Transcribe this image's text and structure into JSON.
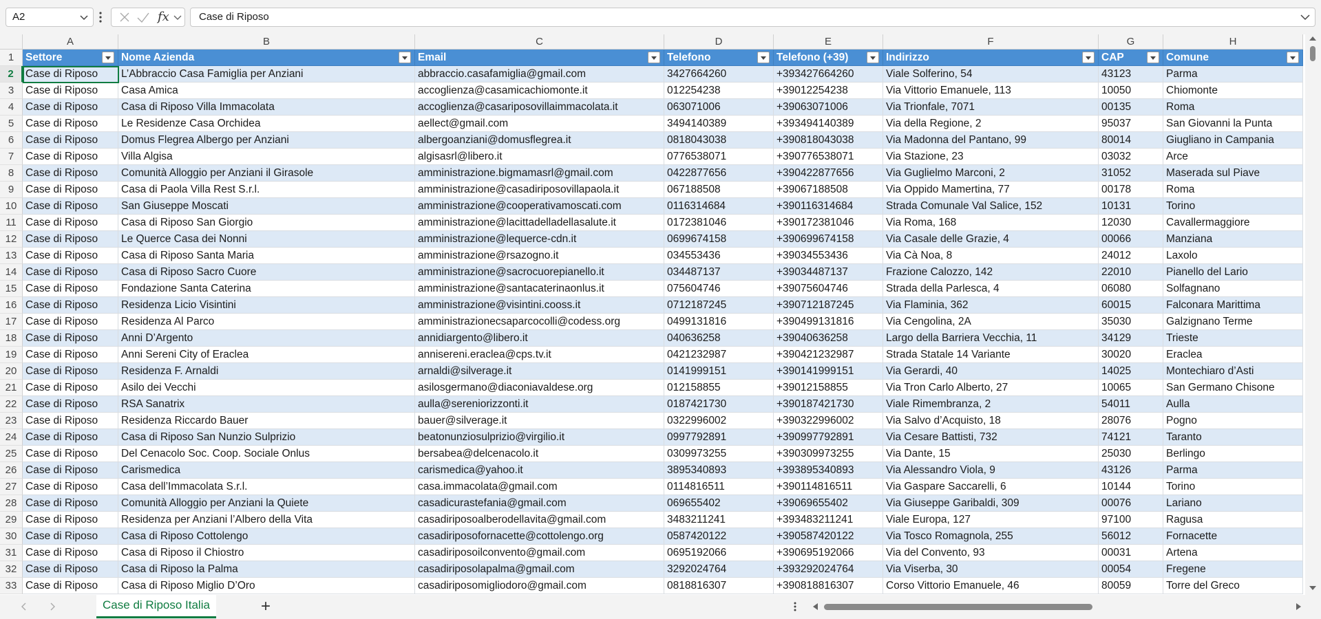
{
  "formula_bar": {
    "name_box": "A2",
    "formula": "Case di Riposo",
    "fx_label": "fx"
  },
  "columns": [
    "A",
    "B",
    "C",
    "D",
    "E",
    "F",
    "G",
    "H"
  ],
  "row_numbers": [
    "1",
    "2",
    "3",
    "4",
    "5",
    "6",
    "7",
    "8",
    "9",
    "10",
    "11",
    "12",
    "13",
    "14",
    "15",
    "16",
    "17",
    "18",
    "19",
    "20",
    "21",
    "22",
    "23",
    "24",
    "25",
    "26",
    "27",
    "28",
    "29",
    "30",
    "31",
    "32",
    "33"
  ],
  "table": {
    "headers": [
      "Settore",
      "Nome Azienda",
      "Email",
      "Telefono",
      "Telefono (+39)",
      "Indirizzo",
      "CAP",
      "Comune"
    ],
    "rows": [
      [
        "Case di Riposo",
        "L’Abbraccio Casa Famiglia per Anziani",
        "abbraccio.casafamiglia@gmail.com",
        "3427664260",
        "+393427664260",
        "Viale Solferino, 54",
        "43123",
        "Parma"
      ],
      [
        "Case di Riposo",
        "Casa Amica",
        "accoglienza@casamicachiomonte.it",
        "012254238",
        "+39012254238",
        "Via Vittorio Emanuele, 113",
        "10050",
        "Chiomonte"
      ],
      [
        "Case di Riposo",
        "Casa di Riposo Villa Immacolata",
        "accoglienza@casariposovillaimmacolata.it",
        "063071006",
        "+39063071006",
        "Via Trionfale, 7071",
        "00135",
        "Roma"
      ],
      [
        "Case di Riposo",
        "Le Residenze Casa Orchidea",
        "aellect@gmail.com",
        "3494140389",
        "+393494140389",
        "Via della Regione, 2",
        "95037",
        "San Giovanni la Punta"
      ],
      [
        "Case di Riposo",
        "Domus Flegrea Albergo per Anziani",
        "albergoanziani@domusflegrea.it",
        "0818043038",
        "+390818043038",
        "Via Madonna del Pantano, 99",
        "80014",
        "Giugliano in Campania"
      ],
      [
        "Case di Riposo",
        "Villa Algisa",
        "algisasrl@libero.it",
        "0776538071",
        "+390776538071",
        "Via Stazione, 23",
        "03032",
        "Arce"
      ],
      [
        "Case di Riposo",
        "Comunità Alloggio per Anziani il Girasole",
        "amministrazione.bigmamasrl@gmail.com",
        "0422877656",
        "+390422877656",
        "Via Guglielmo Marconi, 2",
        "31052",
        "Maserada sul Piave"
      ],
      [
        "Case di Riposo",
        "Casa di Paola Villa Rest S.r.l.",
        "amministrazione@casadiriposovillapaola.it",
        "067188508",
        "+39067188508",
        "Via Oppido Mamertina, 77",
        "00178",
        "Roma"
      ],
      [
        "Case di Riposo",
        "San Giuseppe Moscati",
        "amministrazione@cooperativamoscati.com",
        "0116314684",
        "+390116314684",
        "Strada Comunale Val Salice, 152",
        "10131",
        "Torino"
      ],
      [
        "Case di Riposo",
        "Casa di Riposo San Giorgio",
        "amministrazione@lacittadelladellasalute.it",
        "0172381046",
        "+390172381046",
        "Via Roma, 168",
        "12030",
        "Cavallermaggiore"
      ],
      [
        "Case di Riposo",
        "Le Querce Casa dei Nonni",
        "amministrazione@lequerce-cdn.it",
        "0699674158",
        "+390699674158",
        "Via Casale delle Grazie, 4",
        "00066",
        "Manziana"
      ],
      [
        "Case di Riposo",
        "Casa di Riposo Santa Maria",
        "amministrazione@rsazogno.it",
        "034553436",
        "+39034553436",
        "Via Cà Noa, 8",
        "24012",
        "Laxolo"
      ],
      [
        "Case di Riposo",
        "Casa di Riposo Sacro Cuore",
        "amministrazione@sacrocuorepianello.it",
        "034487137",
        "+39034487137",
        "Frazione Calozzo, 142",
        "22010",
        "Pianello del Lario"
      ],
      [
        "Case di Riposo",
        "Fondazione Santa Caterina",
        "amministrazione@santacaterinaonlus.it",
        "075604746",
        "+39075604746",
        "Strada della Parlesca, 4",
        "06080",
        "Solfagnano"
      ],
      [
        "Case di Riposo",
        "Residenza Licio Visintini",
        "amministrazione@visintini.cooss.it",
        "0712187245",
        "+390712187245",
        "Via Flaminia, 362",
        "60015",
        "Falconara Marittima"
      ],
      [
        "Case di Riposo",
        "Residenza Al Parco",
        "amministrazionecsaparcocolli@codess.org",
        "0499131816",
        "+390499131816",
        "Via Cengolina, 2A",
        "35030",
        "Galzignano Terme"
      ],
      [
        "Case di Riposo",
        "Anni D’Argento",
        "annidiargento@libero.it",
        "040636258",
        "+39040636258",
        "Largo della Barriera Vecchia, 11",
        "34129",
        "Trieste"
      ],
      [
        "Case di Riposo",
        "Anni Sereni City of Eraclea",
        "annisereni.eraclea@cps.tv.it",
        "0421232987",
        "+390421232987",
        "Strada Statale 14 Variante",
        "30020",
        "Eraclea"
      ],
      [
        "Case di Riposo",
        "Residenza F. Arnaldi",
        "arnaldi@silverage.it",
        "0141999151",
        "+390141999151",
        "Via Gerardi, 40",
        "14025",
        "Montechiaro d’Asti"
      ],
      [
        "Case di Riposo",
        "Asilo dei Vecchi",
        "asilosgermano@diaconiavaldese.org",
        "012158855",
        "+39012158855",
        "Via Tron Carlo Alberto, 27",
        "10065",
        "San Germano Chisone"
      ],
      [
        "Case di Riposo",
        "RSA Sanatrix",
        "aulla@sereniorizzonti.it",
        "0187421730",
        "+390187421730",
        "Viale Rimembranza, 2",
        "54011",
        "Aulla"
      ],
      [
        "Case di Riposo",
        "Residenza Riccardo Bauer",
        "bauer@silverage.it",
        "0322996002",
        "+390322996002",
        "Via Salvo d’Acquisto, 18",
        "28076",
        "Pogno"
      ],
      [
        "Case di Riposo",
        "Casa di Riposo San Nunzio Sulprizio",
        "beatonunziosulprizio@virgilio.it",
        "0997792891",
        "+390997792891",
        "Via Cesare Battisti, 732",
        "74121",
        "Taranto"
      ],
      [
        "Case di Riposo",
        "Del Cenacolo Soc. Coop. Sociale Onlus",
        "bersabea@delcenacolo.it",
        "0309973255",
        "+390309973255",
        "Via Dante, 15",
        "25030",
        "Berlingo"
      ],
      [
        "Case di Riposo",
        "Carismedica",
        "carismedica@yahoo.it",
        "3895340893",
        "+393895340893",
        "Via Alessandro Viola, 9",
        "43126",
        "Parma"
      ],
      [
        "Case di Riposo",
        "Casa dell’Immacolata S.r.l.",
        "casa.immacolata@gmail.com",
        "0114816511",
        "+390114816511",
        "Via Gaspare Saccarelli, 6",
        "10144",
        "Torino"
      ],
      [
        "Case di Riposo",
        "Comunità Alloggio per Anziani la Quiete",
        "casadicurastefania@gmail.com",
        "069655402",
        "+39069655402",
        "Via Giuseppe Garibaldi, 309",
        "00076",
        "Lariano"
      ],
      [
        "Case di Riposo",
        "Residenza per Anziani l’Albero della Vita",
        "casadiriposoalberodellavita@gmail.com",
        "3483211241",
        "+393483211241",
        "Viale Europa, 127",
        "97100",
        "Ragusa"
      ],
      [
        "Case di Riposo",
        "Casa di Riposo Cottolengo",
        "casadiriposofornacette@cottolengo.org",
        "0587420122",
        "+390587420122",
        "Via Tosco Romagnola, 255",
        "56012",
        "Fornacette"
      ],
      [
        "Case di Riposo",
        "Casa di Riposo il Chiostro",
        "casadiriposoilconvento@gmail.com",
        "0695192066",
        "+390695192066",
        "Via del Convento, 93",
        "00031",
        "Artena"
      ],
      [
        "Case di Riposo",
        "Casa di Riposo la Palma",
        "casadiriposolapalma@gmail.com",
        "3292024764",
        "+393292024764",
        "Via Viserba, 30",
        "00054",
        "Fregene"
      ],
      [
        "Case di Riposo",
        "Casa di Riposo Miglio D’Oro",
        "casadiriposomigliodoro@gmail.com",
        "0818816307",
        "+390818816307",
        "Corso Vittorio Emanuele, 46",
        "80059",
        "Torre del Greco"
      ]
    ]
  },
  "sheet_tabs": {
    "active": "Case di Riposo Italia",
    "add_label": "+"
  },
  "colors": {
    "header_fill": "#4a8fd4",
    "band_fill": "#dde9f6",
    "selection": "#107c41"
  }
}
